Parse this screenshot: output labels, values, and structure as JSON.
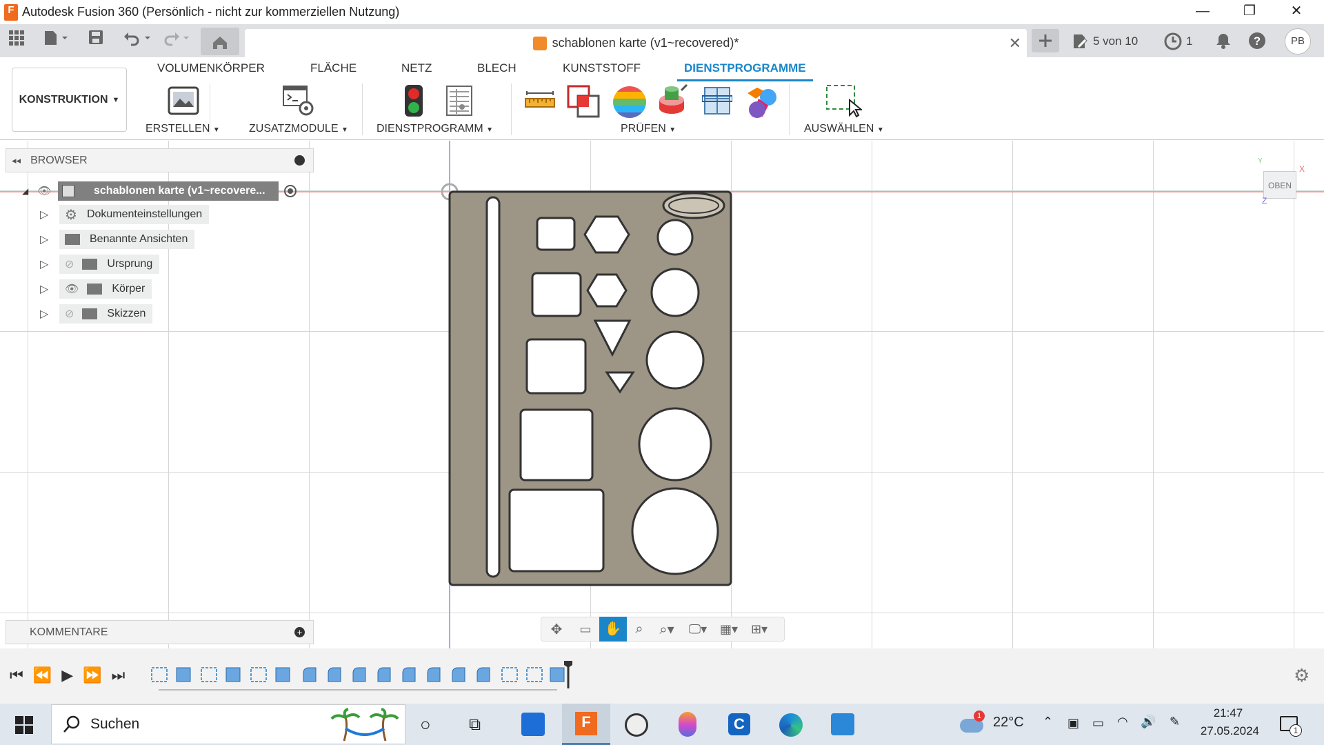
{
  "window": {
    "app_icon": "F",
    "title": "Autodesk Fusion 360 (Persönlich - nicht zur kommerziellen Nutzung)",
    "minimize": "—",
    "restore": "❐",
    "close": "✕"
  },
  "app_toolbar": {
    "doc_title": "schablonen karte (v1~recovered)*",
    "version_label": "5 von 10",
    "jobs_count": "1",
    "user_initials": "PB"
  },
  "ribbon": {
    "workspace": "KONSTRUKTION",
    "tabs": [
      "VOLUMENKÖRPER",
      "FLÄCHE",
      "NETZ",
      "BLECH",
      "KUNSTSTOFF",
      "DIENSTPROGRAMME"
    ],
    "active_tab": "DIENSTPROGRAMME",
    "groups": [
      "ERSTELLEN",
      "ZUSATZMODULE",
      "DIENSTPROGRAMM",
      "PRÜFEN",
      "AUSWÄHLEN"
    ]
  },
  "browser": {
    "title": "BROWSER",
    "root": "schablonen karte (v1~recovere...",
    "items": [
      {
        "label": "Dokumenteinstellungen",
        "icon": "gear-icon"
      },
      {
        "label": "Benannte Ansichten",
        "icon": "folder-icon"
      },
      {
        "label": "Ursprung",
        "icon": "folder-icon",
        "visibility": "hidden"
      },
      {
        "label": "Körper",
        "icon": "folder-icon",
        "visibility": "visible"
      },
      {
        "label": "Skizzen",
        "icon": "folder-icon",
        "visibility": "hidden"
      }
    ]
  },
  "comments": {
    "title": "KOMMENTARE"
  },
  "viewcube": {
    "face": "OBEN",
    "axis_x": "X",
    "axis_y": "Y",
    "axis_z": "Z"
  },
  "taskbar": {
    "search_placeholder": "Suchen",
    "weather": "22°C",
    "time": "21:47",
    "date": "27.05.2024",
    "notification_count": "1",
    "weather_badge": "1"
  }
}
